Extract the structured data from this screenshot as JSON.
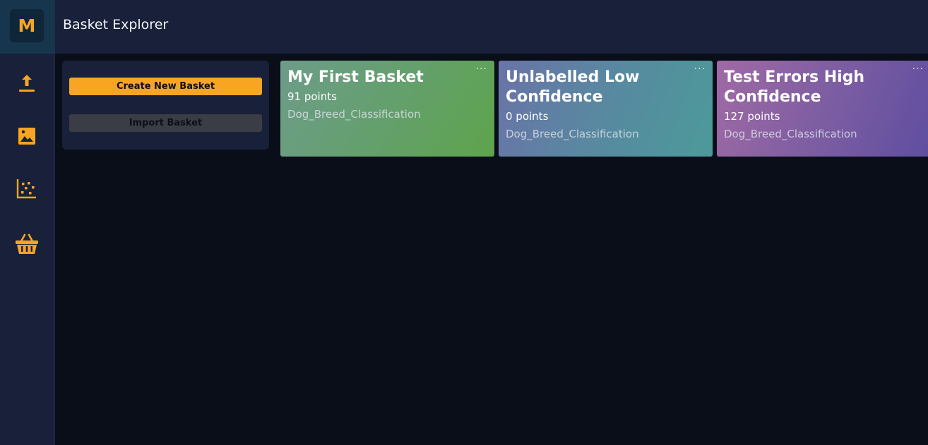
{
  "app": {
    "logo_letter": "M",
    "title": "Basket Explorer"
  },
  "sidebar": {
    "items": [
      {
        "name": "upload",
        "icon": "upload-icon"
      },
      {
        "name": "images",
        "icon": "image-icon"
      },
      {
        "name": "scatter",
        "icon": "scatter-plot-icon"
      },
      {
        "name": "baskets",
        "icon": "basket-icon"
      }
    ]
  },
  "actions": {
    "create_label": "Create New Basket",
    "import_label": "Import Basket"
  },
  "baskets": [
    {
      "title": "My First Basket",
      "points": "91 points",
      "dataset": "Dog_Breed_Classification",
      "menu": "···"
    },
    {
      "title": "Unlabelled Low Confidence",
      "points": "0 points",
      "dataset": "Dog_Breed_Classification",
      "menu": "···"
    },
    {
      "title": "Test Errors High Confidence",
      "points": "127 points",
      "dataset": "Dog_Breed_Classification",
      "menu": "···"
    }
  ],
  "colors": {
    "accent": "#f8a523",
    "sidebar_bg": "#19213a",
    "page_bg": "#0a0e19"
  }
}
